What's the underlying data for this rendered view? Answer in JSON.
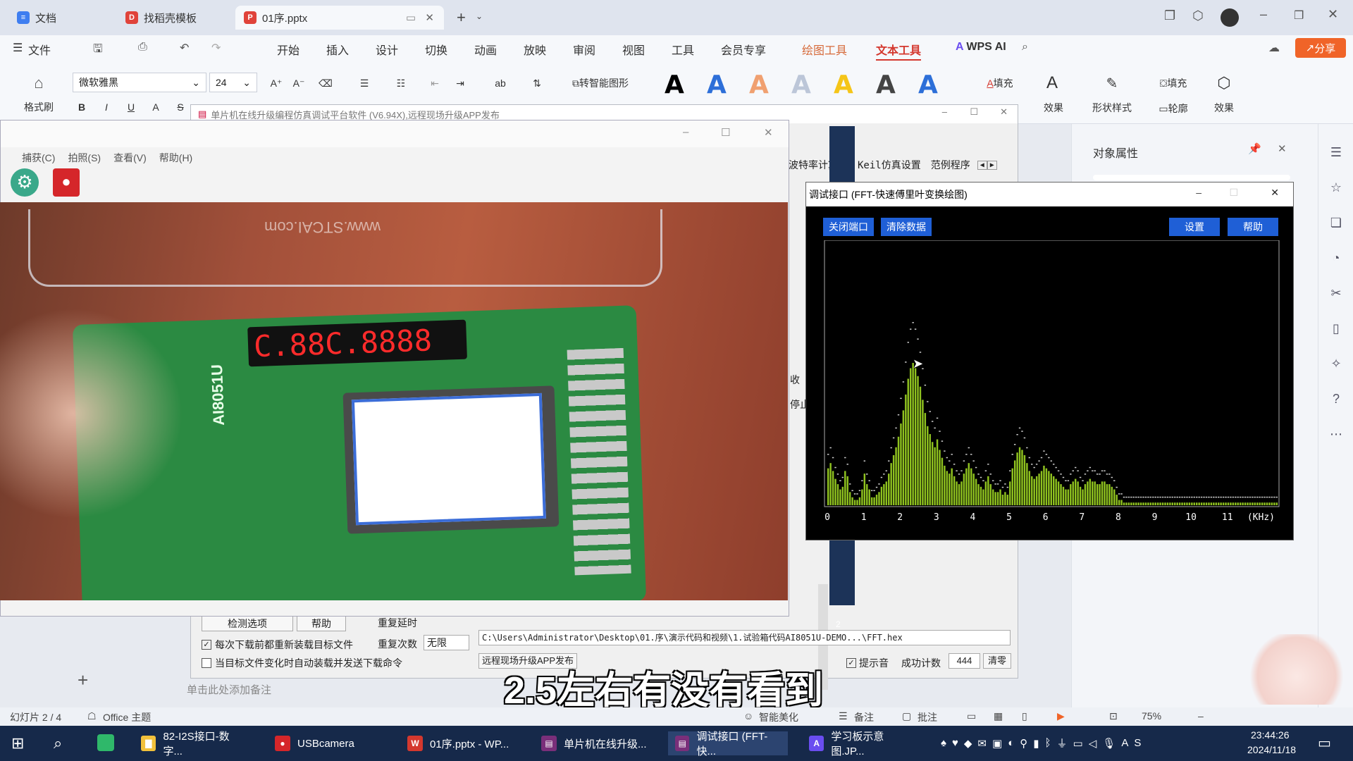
{
  "tabs": [
    {
      "label": "文档"
    },
    {
      "label": "找稻壳模板"
    },
    {
      "label": "01序.pptx"
    }
  ],
  "menubar": {
    "file": "文件",
    "items": [
      "开始",
      "插入",
      "设计",
      "切换",
      "动画",
      "放映",
      "审阅",
      "视图",
      "工具",
      "会员专享",
      "绘图工具",
      "文本工具"
    ],
    "wps_ai": "WPS AI",
    "share": "分享"
  },
  "ribbon": {
    "format_painter": "格式刷",
    "font_name": "微软雅黑",
    "font_size": "24",
    "smart_shape": "转智能图形",
    "fill": "填充",
    "effect": "效果",
    "shape_style": "形状样式",
    "outline": "轮廓",
    "fill2": "填充",
    "effect2": "效果"
  },
  "right_panel": {
    "title": "对象属性"
  },
  "programmer": {
    "title": "单片机在线升级编程仿真调试平台软件 (V6.94X),远程现场升级APP发布",
    "tabs": [
      "波特率计算器",
      "Keil仿真设置",
      "范例程序"
    ],
    "check_opts": "检测选项",
    "help": "帮助",
    "repeat_delay": "重复延时",
    "repeat_count": "重复次数",
    "repeat_value": "无限",
    "opt1": "每次下载前都重新装载目标文件",
    "opt2": "当目标文件变化时自动装载并发送下载命令",
    "path": "C:\\Users\\Administrator\\Desktop\\01.序\\演示代码和视频\\1.试验箱代码AI8051U-DEMO...\\FFT.hex",
    "remote": "远程现场升级APP发布",
    "tip_label": "提示音",
    "success_label": "成功计数",
    "success_count": "444",
    "clear": "清零",
    "side1": "收",
    "side2": "停止",
    "page_num": "2"
  },
  "camera": {
    "menu": [
      "捕获(C)",
      "拍照(S)",
      "查看(V)",
      "帮助(H)"
    ],
    "board_label": "AI8051U",
    "site": "www.STCAI.com",
    "display": "C.88C.8888"
  },
  "fft": {
    "title": "调试接口 (FFT-快速傅里叶变换绘图)",
    "btn_close_port": "关闭端口",
    "btn_clear": "清除数据",
    "btn_settings": "设置",
    "btn_help": "帮助",
    "axis_unit": "(KHz)"
  },
  "chart_data": {
    "type": "bar",
    "title": "",
    "xlabel": "(KHz)",
    "ylabel": "",
    "xlim": [
      0,
      12.4
    ],
    "ylim": [
      0,
      1
    ],
    "x_ticks": [
      "0",
      "1",
      "2",
      "3",
      "4",
      "5",
      "6",
      "7",
      "8",
      "9",
      "10",
      "11"
    ],
    "values": [
      0.14,
      0.16,
      0.13,
      0.1,
      0.08,
      0.06,
      0.07,
      0.13,
      0.11,
      0.05,
      0.03,
      0.02,
      0.02,
      0.03,
      0.06,
      0.12,
      0.08,
      0.06,
      0.03,
      0.03,
      0.04,
      0.05,
      0.07,
      0.08,
      0.09,
      0.12,
      0.16,
      0.19,
      0.22,
      0.26,
      0.31,
      0.36,
      0.42,
      0.48,
      0.52,
      0.54,
      0.52,
      0.49,
      0.45,
      0.4,
      0.35,
      0.3,
      0.27,
      0.24,
      0.22,
      0.25,
      0.21,
      0.18,
      0.15,
      0.13,
      0.12,
      0.14,
      0.11,
      0.09,
      0.08,
      0.09,
      0.12,
      0.14,
      0.16,
      0.14,
      0.12,
      0.1,
      0.08,
      0.07,
      0.06,
      0.09,
      0.11,
      0.08,
      0.06,
      0.05,
      0.05,
      0.06,
      0.04,
      0.05,
      0.04,
      0.09,
      0.14,
      0.17,
      0.2,
      0.22,
      0.21,
      0.19,
      0.16,
      0.13,
      0.11,
      0.1,
      0.11,
      0.12,
      0.13,
      0.15,
      0.14,
      0.13,
      0.12,
      0.11,
      0.1,
      0.09,
      0.08,
      0.07,
      0.06,
      0.06,
      0.08,
      0.09,
      0.1,
      0.09,
      0.07,
      0.06,
      0.08,
      0.09,
      0.1,
      0.09,
      0.09,
      0.08,
      0.08,
      0.09,
      0.09,
      0.08,
      0.08,
      0.07,
      0.06,
      0.04,
      0.02,
      0.02,
      0.01,
      0.01,
      0.01,
      0.01,
      0.01,
      0.01,
      0.01,
      0.01,
      0.01,
      0.01,
      0.01,
      0.01,
      0.01,
      0.01,
      0.01,
      0.01,
      0.01,
      0.01,
      0.01,
      0.01,
      0.01,
      0.01,
      0.01,
      0.01,
      0.01,
      0.01,
      0.01,
      0.01,
      0.01,
      0.01,
      0.01,
      0.01,
      0.01,
      0.01,
      0.01,
      0.01,
      0.01,
      0.01,
      0.01,
      0.01,
      0.01,
      0.01,
      0.01,
      0.01,
      0.01,
      0.01,
      0.01,
      0.01,
      0.01,
      0.01,
      0.01,
      0.01,
      0.01,
      0.01,
      0.01,
      0.01,
      0.01,
      0.01,
      0.01,
      0.01,
      0.01,
      0.01,
      0.01,
      0.01
    ],
    "bar_color": "#8fc21f",
    "peak_color": "#cccccc"
  },
  "subtitle": "2.5左右有没有看到",
  "status": {
    "slide": "幻灯片 2 / 4",
    "theme": "Office 主题",
    "notes": "单击此处添加备注",
    "beautify": "智能美化",
    "remarks": "备注",
    "comments": "批注",
    "zoom": "75%"
  },
  "taskbar": {
    "items": [
      "82-I2S接口-数字...",
      "USBcamera",
      "01序.pptx - WP...",
      "单片机在线升级...",
      "调试接口 (FFT-快...",
      "学习板示意图.JP..."
    ],
    "time": "23:44:26",
    "date": "2024/11/18"
  },
  "colors": {
    "accent": "#1f5fd6",
    "wps_red": "#d4382e",
    "taskbar": "#16294a"
  }
}
